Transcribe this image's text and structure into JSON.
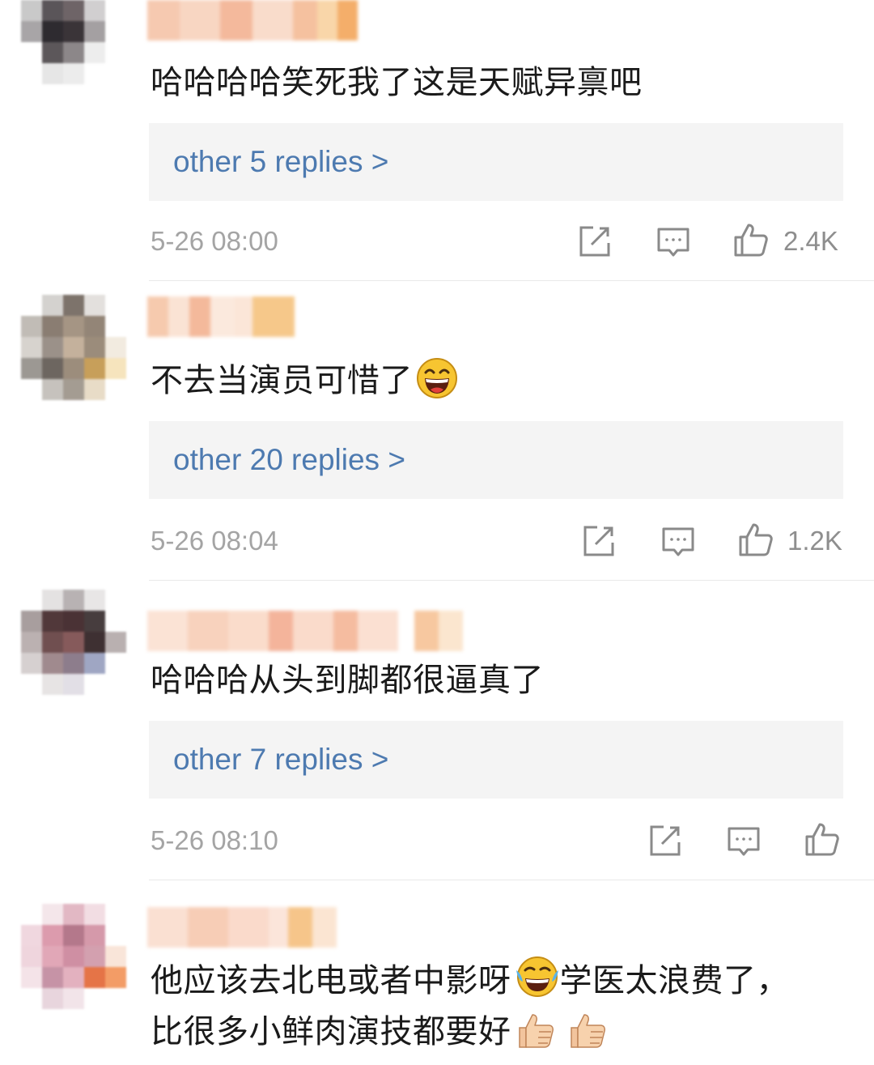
{
  "comments": [
    {
      "text": "哈哈哈哈笑死我了这是天赋异禀吧",
      "replies_label": "other 5 replies >",
      "timestamp": "5-26 08:00",
      "likes": "2.4K"
    },
    {
      "text": "不去当演员可惜了",
      "emoji": "grinning-laughing-emoji",
      "replies_label": "other 20 replies >",
      "timestamp": "5-26 08:04",
      "likes": "1.2K"
    },
    {
      "text": "哈哈哈从头到脚都很逼真了",
      "replies_label": "other 7 replies >",
      "timestamp": "5-26 08:10",
      "likes": ""
    },
    {
      "text_line1": "他应该去北电或者中影呀",
      "emoji1": "crying-laughing-emoji",
      "text_line1b": "学医太浪费了，",
      "text_line2": "比很多小鲜肉演技都要好",
      "emoji2": "thumbs-up-emoji"
    }
  ],
  "icons": {
    "share": "share-icon",
    "comment": "comment-icon",
    "like": "like-icon"
  },
  "colors": {
    "link": "#4d7ab0",
    "reply_box_bg": "#f4f4f4",
    "meta_text": "#a4a4a4"
  }
}
